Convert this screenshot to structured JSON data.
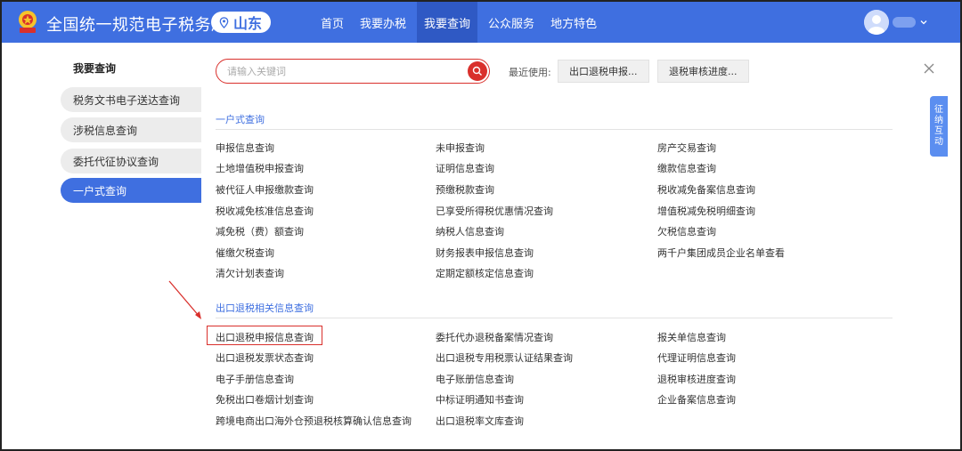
{
  "header": {
    "site_title": "全国统一规范电子税务局",
    "province": "山东",
    "nav": [
      "首页",
      "我要办税",
      "我要查询",
      "公众服务",
      "地方特色"
    ],
    "active_nav": 2,
    "brand_color": "#3f6fe0"
  },
  "sidebar": {
    "title": "我要查询",
    "items": [
      "税务文书电子送达查询",
      "涉税信息查询",
      "委托代征协议查询",
      "一户式查询"
    ],
    "active_index": 3
  },
  "search": {
    "placeholder": "请输入关键词",
    "recent_label": "最近使用:",
    "recent": [
      "出口退税申报...",
      "退税审核进度..."
    ]
  },
  "sections": [
    {
      "title": "一户式查询",
      "items": [
        [
          "申报信息查询",
          "未申报查询",
          "房产交易查询"
        ],
        [
          "土地增值税申报查询",
          "证明信息查询",
          "缴款信息查询"
        ],
        [
          "被代征人申报缴款查询",
          "预缴税款查询",
          "税收减免备案信息查询"
        ],
        [
          "税收减免核准信息查询",
          "已享受所得税优惠情况查询",
          "增值税减免税明细查询"
        ],
        [
          "减免税（费）额查询",
          "纳税人信息查询",
          "欠税信息查询"
        ],
        [
          "催缴欠税查询",
          "财务报表申报信息查询",
          "两千户集团成员企业名单查看"
        ],
        [
          "清欠计划表查询",
          "定期定额核定信息查询",
          ""
        ]
      ]
    },
    {
      "title": "出口退税相关信息查询",
      "items": [
        [
          "出口退税申报信息查询",
          "委托代办退税备案情况查询",
          "报关单信息查询"
        ],
        [
          "出口退税发票状态查询",
          "出口退税专用税票认证结果查询",
          "代理证明信息查询"
        ],
        [
          "电子手册信息查询",
          "电子账册信息查询",
          "退税审核进度查询"
        ],
        [
          "免税出口卷烟计划查询",
          "中标证明通知书查询",
          "企业备案信息查询"
        ],
        [
          "跨境电商出口海外仓预退税核算确认信息查询",
          "出口退税率文库查询",
          ""
        ]
      ]
    }
  ],
  "side_tab": [
    "征",
    "纳",
    "互",
    "动"
  ],
  "icons": [
    "emblem-icon",
    "location-pin-icon",
    "search-icon",
    "close-icon",
    "user-avatar-icon",
    "chevron-down-icon",
    "red-arrow-icon"
  ],
  "highlight_color": "#d9302c"
}
